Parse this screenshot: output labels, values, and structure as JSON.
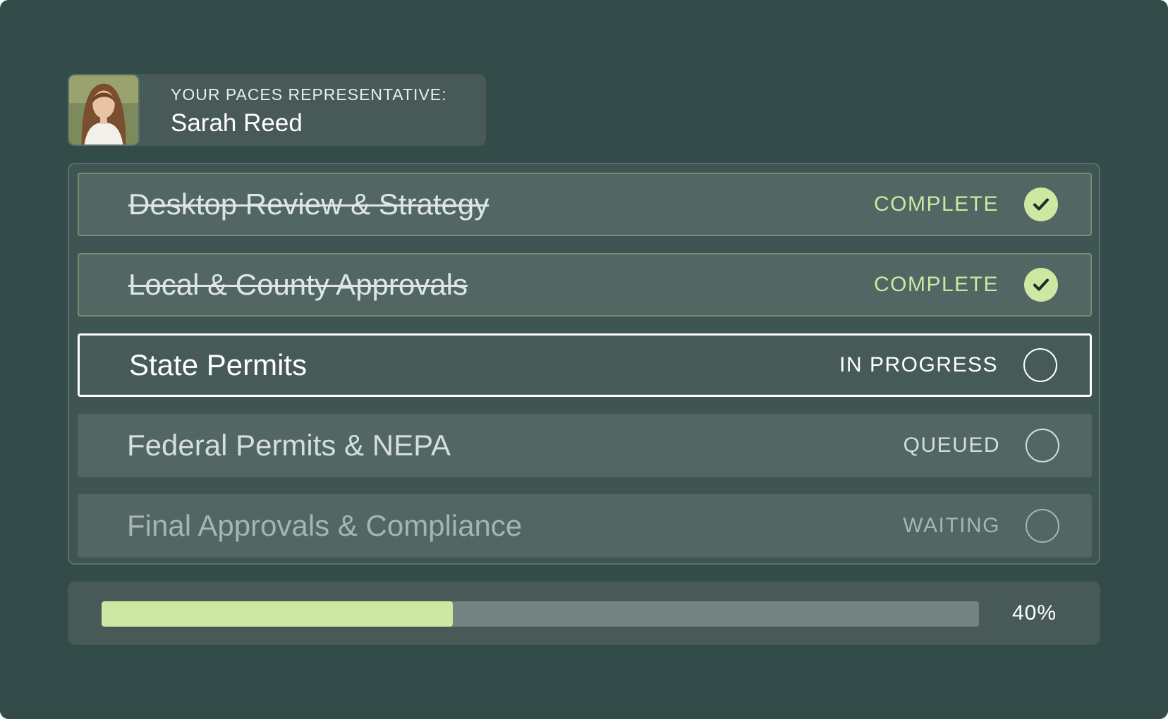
{
  "representative": {
    "label": "YOUR PACES REPRESENTATIVE:",
    "name": "Sarah Reed",
    "photo_icon": "avatar-photo"
  },
  "steps": [
    {
      "title": "Desktop Review & Strategy",
      "status": "COMPLETE",
      "state": "complete"
    },
    {
      "title": "Local & County Approvals",
      "status": "COMPLETE",
      "state": "complete"
    },
    {
      "title": "State Permits",
      "status": "IN PROGRESS",
      "state": "active"
    },
    {
      "title": "Federal Permits & NEPA",
      "status": "QUEUED",
      "state": "queued"
    },
    {
      "title": "Final Approvals & Compliance",
      "status": "WAITING",
      "state": "waiting"
    }
  ],
  "progress": {
    "value": 0.4,
    "label": "40%"
  },
  "colors": {
    "background": "#334b49",
    "accent": "#cce8a2",
    "active_border": "#ffffff"
  }
}
